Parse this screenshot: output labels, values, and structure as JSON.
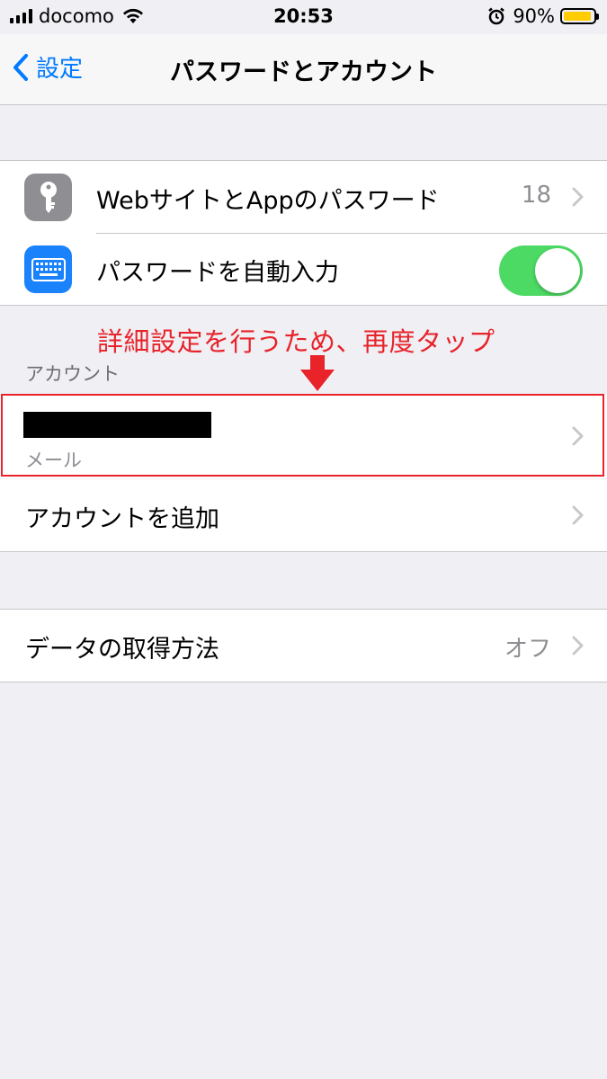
{
  "status_bar": {
    "carrier": "docomo",
    "time": "20:53",
    "battery_percent": "90%",
    "battery_level": 0.9,
    "icons": [
      "signal-icon",
      "wifi-icon",
      "alarm-icon",
      "battery-icon"
    ]
  },
  "nav": {
    "back_label": "設定",
    "title": "パスワードとアカウント"
  },
  "passwords_group": {
    "website_passwords": {
      "label": "WebサイトとAppのパスワード",
      "count": "18",
      "icon": "key-icon"
    },
    "autofill": {
      "label": "パスワードを自動入力",
      "enabled": true,
      "icon": "keyboard-icon"
    }
  },
  "annotation": {
    "text": "詳細設定を行うため、再度タップ"
  },
  "accounts_section": {
    "header": "アカウント",
    "account_type": "メール",
    "add_account_label": "アカウントを追加"
  },
  "fetch_group": {
    "label": "データの取得方法",
    "value": "オフ"
  },
  "colors": {
    "accent": "#007aff",
    "toggle_on": "#4cd964",
    "annotation": "#e8232a",
    "key_icon_bg": "#8e8e93",
    "keyboard_icon_bg": "#1a82fb"
  }
}
